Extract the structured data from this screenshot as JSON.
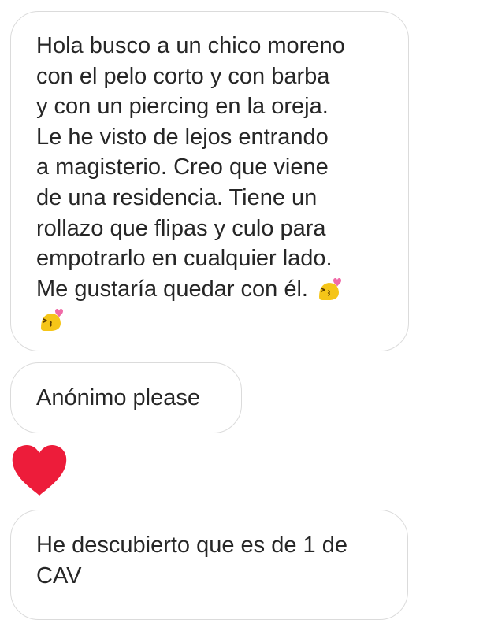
{
  "colors": {
    "bubble_border": "#dbdbdb",
    "text": "#262626",
    "heart": "#ed1c3a",
    "emoji_face": "#f5c518",
    "emoji_heart": "#f06aa7"
  },
  "messages": [
    {
      "lines": [
        "Hola busco a un chico moreno",
        "con el pelo corto y con barba",
        "y con un piercing en la oreja.",
        "Le he visto de lejos entrando",
        "a magisterio. Creo que viene",
        "de una residencia. Tiene un",
        "rollazo que flipas y culo para",
        "empotrarlo en cualquier lado.",
        "Me gustaría quedar con él."
      ],
      "trailing_emojis": [
        "kissing-face-heart-emoji",
        "kissing-face-heart-emoji"
      ]
    },
    {
      "lines": [
        "Anónimo please"
      ]
    },
    {
      "reaction": "heart-icon"
    },
    {
      "lines": [
        "He descubierto que es de 1 de",
        "CAV"
      ]
    }
  ]
}
